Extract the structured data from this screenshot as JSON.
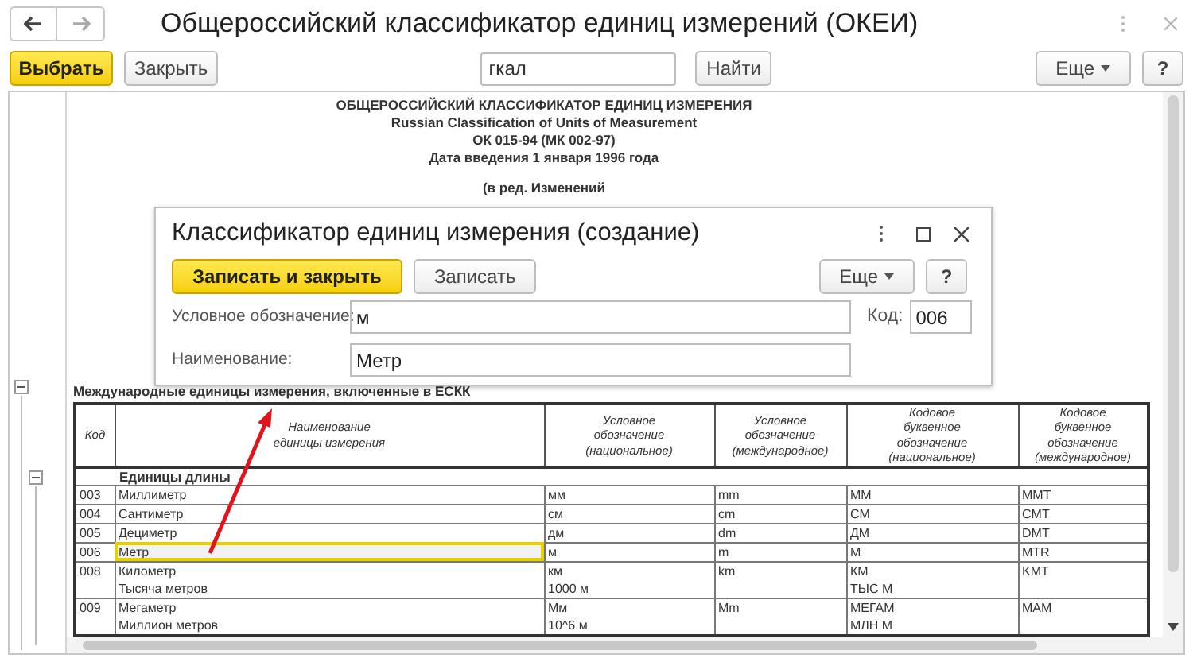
{
  "window": {
    "title": "Общероссийский классификатор единиц измерений (ОКЕИ)"
  },
  "toolbar": {
    "select_button": "Выбрать",
    "close_button": "Закрыть",
    "search_value": "гкал",
    "find_button": "Найти",
    "more_button": "Еще",
    "help_button": "?"
  },
  "report": {
    "header_lines": [
      "ОБЩЕРОССИЙСКИЙ КЛАССИФИКАТОР ЕДИНИЦ ИЗМЕРЕНИЯ",
      "Russian Classification of Units of Measurement",
      "ОК 015-94 (МК 002-97)",
      "Дата введения 1 января 1996 года"
    ],
    "revision": "(в ред. Изменений",
    "section_title": "Международные единицы измерения, включенные в ЕСКК",
    "outline": [
      {
        "expanded": true
      },
      {
        "expanded": true
      }
    ],
    "columns": [
      "Код",
      "Наименование\nединицы измерения",
      "Условное\nобозначение\n(национальное)",
      "Условное\nобозначение\n(международное)",
      "Кодовое\nбуквенное\nобозначение\n(национальное)",
      "Кодовое\nбуквенное\nобозначение\n(международное)"
    ],
    "group": "Единицы длины",
    "rows": [
      {
        "cells": [
          [
            "003"
          ],
          [
            "Миллиметр"
          ],
          [
            "мм"
          ],
          [
            "mm"
          ],
          [
            "ММ"
          ],
          [
            "MMT"
          ]
        ],
        "selected": false
      },
      {
        "cells": [
          [
            "004"
          ],
          [
            "Сантиметр"
          ],
          [
            "см"
          ],
          [
            "cm"
          ],
          [
            "СМ"
          ],
          [
            "CMT"
          ]
        ],
        "selected": false
      },
      {
        "cells": [
          [
            "005"
          ],
          [
            "Дециметр"
          ],
          [
            "дм"
          ],
          [
            "dm"
          ],
          [
            "ДМ"
          ],
          [
            "DMT"
          ]
        ],
        "selected": false
      },
      {
        "cells": [
          [
            "006"
          ],
          [
            "Метр"
          ],
          [
            "м"
          ],
          [
            "m"
          ],
          [
            "М"
          ],
          [
            "MTR"
          ]
        ],
        "selected": true
      },
      {
        "cells": [
          [
            "008"
          ],
          [
            "Километр",
            "Тысяча метров"
          ],
          [
            "км",
            "1000 м"
          ],
          [
            "km"
          ],
          [
            "КМ",
            "ТЫС М"
          ],
          [
            "KMT"
          ]
        ],
        "selected": false
      },
      {
        "cells": [
          [
            "009"
          ],
          [
            "Мегаметр",
            "Миллион метров"
          ],
          [
            "Мм",
            "10^6 м"
          ],
          [
            "Mm"
          ],
          [
            "МЕГАМ",
            "МЛН М"
          ],
          [
            "MAM"
          ]
        ],
        "selected": false
      }
    ]
  },
  "dialog": {
    "title": "Классификатор единиц измерения (создание)",
    "save_close_button": "Записать и закрыть",
    "save_button": "Записать",
    "more_button": "Еще",
    "help_button": "?",
    "fields": [
      {
        "label": "Условное обозначение:",
        "value": "м"
      },
      {
        "label": "Наименование:",
        "value": "Метр"
      }
    ],
    "code_label": "Код:",
    "code_value": "006"
  }
}
